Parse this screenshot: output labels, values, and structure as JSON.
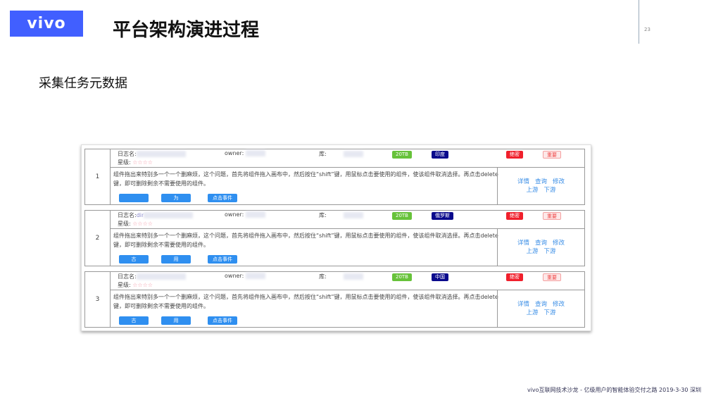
{
  "header": {
    "logo": "vivo",
    "title": "平台架构演进过程",
    "page_number": "23"
  },
  "subtitle": "采集任务元数据",
  "labels": {
    "log_name": "日志名:",
    "owner": "owner:",
    "db": "库:",
    "stars_label": "星级:",
    "stars": "☆☆☆☆"
  },
  "records": [
    {
      "num": "1",
      "log_name": "",
      "size": "20TB",
      "country": "印度",
      "secret": "绝密",
      "importance": "重要",
      "desc": "组件拖出来特别多一个一个删麻烦，这个问题，首先将组件拖入画布中，然后按住“shift”键，用鼠标点击要使用的组件，使该组件取消选择。再点击delete键，即可删除剩余不需要使用的组件。",
      "buttons": [
        "",
        "为",
        "点击事件"
      ]
    },
    {
      "num": "2",
      "log_name": "dir",
      "size": "20TB",
      "country": "俄罗斯",
      "secret": "绝密",
      "importance": "重要",
      "desc": "组件拖出来特别多一个一个删麻烦，这个问题，首先将组件拖入画布中，然后按住“shift”键，用鼠标点击要使用的组件，使该组件取消选择。再点击delete键，即可删除剩余不需要使用的组件。",
      "buttons": [
        "古",
        "用",
        "点击事件"
      ]
    },
    {
      "num": "3",
      "log_name": "",
      "size": "20TB",
      "country": "中国",
      "secret": "绝密",
      "importance": "重要",
      "desc": "组件拖出来特别多一个一个删麻烦，这个问题，首先将组件拖入画布中，然后按住“shift”键，用鼠标点击要使用的组件，使该组件取消选择。再点击delete键，即可删除剩余不需要使用的组件。",
      "buttons": [
        "古",
        "用",
        "点击事件"
      ]
    }
  ],
  "actions": {
    "detail": "详情",
    "query": "查询",
    "edit": "修改",
    "upstream": "上游",
    "downstream": "下游"
  },
  "colors": {
    "brand": "#415fff",
    "size_tag": "#67c23a",
    "country_tag": "#0a0a8c",
    "secret_tag": "#f0202c",
    "link": "#3a8ee6"
  },
  "footer": "vivo互联网技术沙龙 - 亿级用户的智能体验交付之路 2019-3-30 深圳"
}
